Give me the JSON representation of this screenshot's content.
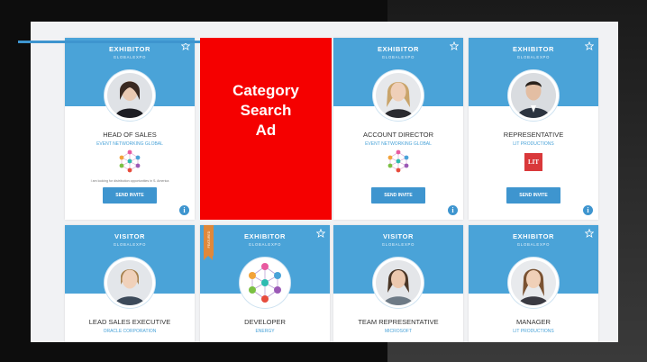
{
  "ad": {
    "line1": "Category",
    "line2": "Search",
    "line3": "Ad"
  },
  "cards": [
    {
      "type": "EXHIBITOR",
      "event": "GLOBALEXPO",
      "title": "HEAD OF SALES",
      "company": "EVENT NETWORKING GLOBAL",
      "note": "I am looking for distribution opportunities in S. America",
      "button": "SEND INVITE",
      "info": "i"
    },
    {
      "type": "EXHIBITOR",
      "event": "GLOBALEXPO",
      "title": "ACCOUNT DIRECTOR",
      "company": "EVENT NETWORKING GLOBAL",
      "button": "SEND INVITE",
      "info": "i"
    },
    {
      "type": "EXHIBITOR",
      "event": "GLOBALEXPO",
      "title": "REPRESENTATIVE",
      "company": "LIT PRODUCTIONS",
      "logo_text": "LIT",
      "button": "SEND INVITE",
      "info": "i"
    },
    {
      "type": "VISITOR",
      "event": "GLOBALEXPO",
      "title": "LEAD SALES EXECUTIVE",
      "company": "ORACLE CORPORATION"
    },
    {
      "type": "EXHIBITOR",
      "event": "GLOBALEXPO",
      "title": "DEVELOPER",
      "company": "ENERGY",
      "ribbon": "FEATURED"
    },
    {
      "type": "VISITOR",
      "event": "GLOBALEXPO",
      "title": "TEAM REPRESENTATIVE",
      "company": "MICROSOFT"
    },
    {
      "type": "EXHIBITOR",
      "event": "GLOBALEXPO",
      "title": "MANAGER",
      "company": "LIT PRODUCTIONS"
    }
  ],
  "colors": {
    "header_blue": "#4aa3d8",
    "button_blue": "#3e95cf",
    "ad_red": "#f50000",
    "ribbon_orange": "#e0883a"
  },
  "icons": [
    "star-icon",
    "info-icon",
    "network-logo-icon",
    "lit-logo-icon"
  ]
}
